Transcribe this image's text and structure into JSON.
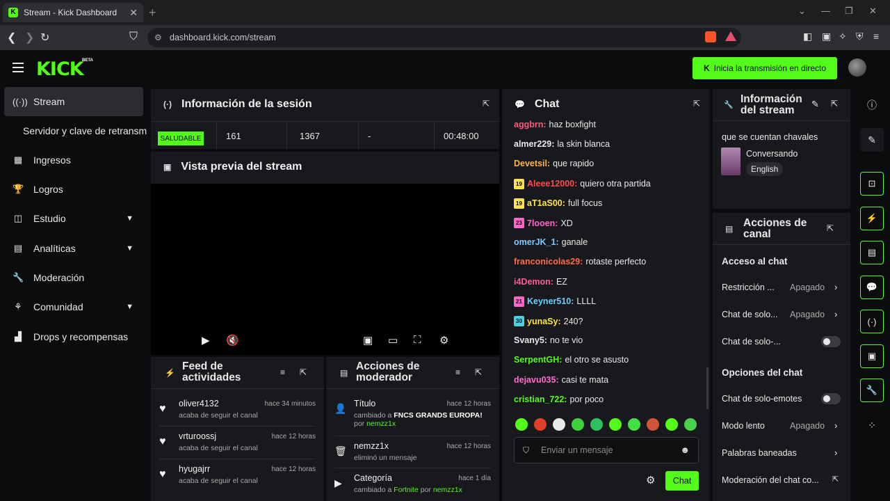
{
  "browser": {
    "tab_title": "Stream - Kick Dashboard",
    "url": "dashboard.kick.com/stream"
  },
  "header": {
    "logo": "KICK",
    "beta": "BETA",
    "go_live_label": "Inicia la transmisión en directo"
  },
  "sidebar": {
    "items": [
      {
        "label": "Stream",
        "icon": "broadcast-icon"
      },
      {
        "label": "Servidor y clave de retransm",
        "icon": ""
      },
      {
        "label": "Ingresos",
        "icon": "bar-chart-icon"
      },
      {
        "label": "Logros",
        "icon": "trophy-icon"
      },
      {
        "label": "Estudio",
        "icon": "studio-icon"
      },
      {
        "label": "Analíticas",
        "icon": "analytics-icon"
      },
      {
        "label": "Moderación",
        "icon": "wrench-icon"
      },
      {
        "label": "Comunidad",
        "icon": "community-icon"
      },
      {
        "label": "Drops y recompensas",
        "icon": "drops-icon"
      }
    ]
  },
  "session": {
    "title": "Información de la sesión",
    "health": "SALUDABLE",
    "viewers": "161",
    "followers": "1367",
    "subs": "-",
    "duration": "00:48:00"
  },
  "preview": {
    "title": "Vista previa del stream"
  },
  "feed": {
    "title_line1": "Feed de",
    "title_line2": "actividades",
    "items": [
      {
        "name": "oliver4132",
        "time": "hace 34 minutos",
        "desc": "acaba de seguir el canal"
      },
      {
        "name": "vrturoossj",
        "time": "hace 12 horas",
        "desc": "acaba de seguir el canal"
      },
      {
        "name": "hyugajrr",
        "time": "hace 12 horas",
        "desc": "acaba de seguir el canal"
      }
    ]
  },
  "modactions": {
    "title_line1": "Acciones de",
    "title_line2": "moderador",
    "items": [
      {
        "name": "Título",
        "time": "hace 12 horas",
        "desc_prefix": "cambiado a ",
        "desc_value": "FNCS GRANDS EUROPA!",
        "by_prefix": "por ",
        "by": "nemzz1x"
      },
      {
        "name": "nemzz1x",
        "time": "hace 12 horas",
        "desc_prefix": "eliminó un mensaje",
        "desc_value": "",
        "by_prefix": "",
        "by": ""
      },
      {
        "name": "Categoría",
        "time": "hace 1 día",
        "desc_prefix": "cambiado a ",
        "desc_value": "Fortnite",
        "by_prefix": " por ",
        "by": "nemzz1x"
      }
    ]
  },
  "chat": {
    "title": "Chat",
    "messages": [
      {
        "user": "aggbrn",
        "color": "#ff5a7a",
        "badge": "",
        "text": "haz boxfight"
      },
      {
        "user": "almer229",
        "color": "#e8e8e8",
        "badge": "",
        "text": "la skin blanca"
      },
      {
        "user": "Devetsil",
        "color": "#ffb347",
        "badge": "",
        "text": "que rapido"
      },
      {
        "user": "Aleee12000",
        "color": "#ff4a4a",
        "badge": "19",
        "text": "quiero otra partida"
      },
      {
        "user": "aT1aS00",
        "color": "#ffe34a",
        "badge": "19",
        "text": "full focus"
      },
      {
        "user": "7looen",
        "color": "#ff66cc",
        "badge": "23",
        "text": "XD"
      },
      {
        "user": "omerJK_1",
        "color": "#7fc8ff",
        "badge": "",
        "text": "ganale"
      },
      {
        "user": "franconicolas29",
        "color": "#ff6a4a",
        "badge": "",
        "text": "rotaste perfecto"
      },
      {
        "user": "i4Demon",
        "color": "#ff5a9a",
        "badge": "",
        "text": "EZ"
      },
      {
        "user": "Keyner510",
        "color": "#6ad0ff",
        "badge": "21",
        "text": "LLLL"
      },
      {
        "user": "yunaSy",
        "color": "#ffe34a",
        "badge": "30",
        "text": "240?"
      },
      {
        "user": "Svany5",
        "color": "#e8e8e8",
        "badge": "",
        "text": "no te vio"
      },
      {
        "user": "SerpentGH",
        "color": "#53fc18",
        "badge": "",
        "text": "el otro se asusto"
      },
      {
        "user": "dejavu035",
        "color": "#ff6ad0",
        "badge": "",
        "text": "casi te mata"
      },
      {
        "user": "cristian_722",
        "color": "#53fc18",
        "badge": "",
        "text": "por poco"
      }
    ],
    "input_placeholder": "Enviar un mensaje",
    "send_label": "Chat"
  },
  "stream_info": {
    "title_line1": "Información",
    "title_line2": "del stream",
    "stream_title": "que se cuentan chavales",
    "category": "Conversando",
    "language": "English"
  },
  "channel_actions": {
    "title_line1": "Acciones de",
    "title_line2": "canal",
    "access_heading": "Acceso al chat",
    "restriction_label": "Restricción ...",
    "restriction_value": "Apagado",
    "solo_label": "Chat de solo...",
    "solo_value": "Apagado",
    "solo2_label": "Chat de solo-...",
    "options_heading": "Opciones del chat",
    "emotes_label": "Chat de solo-emotes",
    "slow_label": "Modo lento",
    "slow_value": "Apagado",
    "banned_label": "Palabras baneadas",
    "moderation_label": "Moderación del chat co..."
  },
  "colors": {
    "accent": "#53fc18",
    "panel": "#18191c",
    "background": "#0b0c0d"
  }
}
